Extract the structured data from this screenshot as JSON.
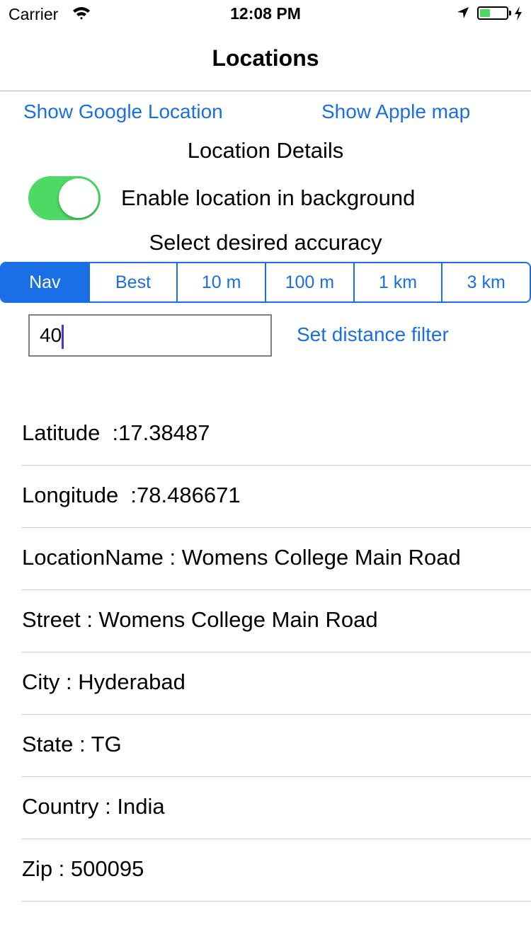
{
  "status_bar": {
    "carrier": "Carrier",
    "time": "12:08 PM",
    "battery_level": 0.4,
    "battery_color": "#4cd964"
  },
  "nav": {
    "title": "Locations"
  },
  "links": {
    "google": "Show Google Location",
    "apple": "Show Apple map",
    "distance_filter": "Set distance filter"
  },
  "details": {
    "title": "Location Details",
    "background_toggle_label": "Enable location in background",
    "background_toggle_on": true,
    "accuracy_title": "Select desired accuracy"
  },
  "accuracy_options": [
    "Nav",
    "Best",
    "10 m",
    "100 m",
    "1 km",
    "3 km"
  ],
  "accuracy_selected": "Nav",
  "distance_input": {
    "value": "40",
    "placeholder": ""
  },
  "info": {
    "latitude": "Latitude  :17.38487",
    "longitude": "Longitude  :78.486671",
    "location_name": "LocationName : Womens College Main Road",
    "street": "Street : Womens College Main Road",
    "city": "City : Hyderabad",
    "state": "State : TG",
    "country": "Country : India",
    "zip": "Zip : 500095"
  },
  "colors": {
    "accent": "#1a6ee6",
    "toggle_on": "#4cd964"
  }
}
